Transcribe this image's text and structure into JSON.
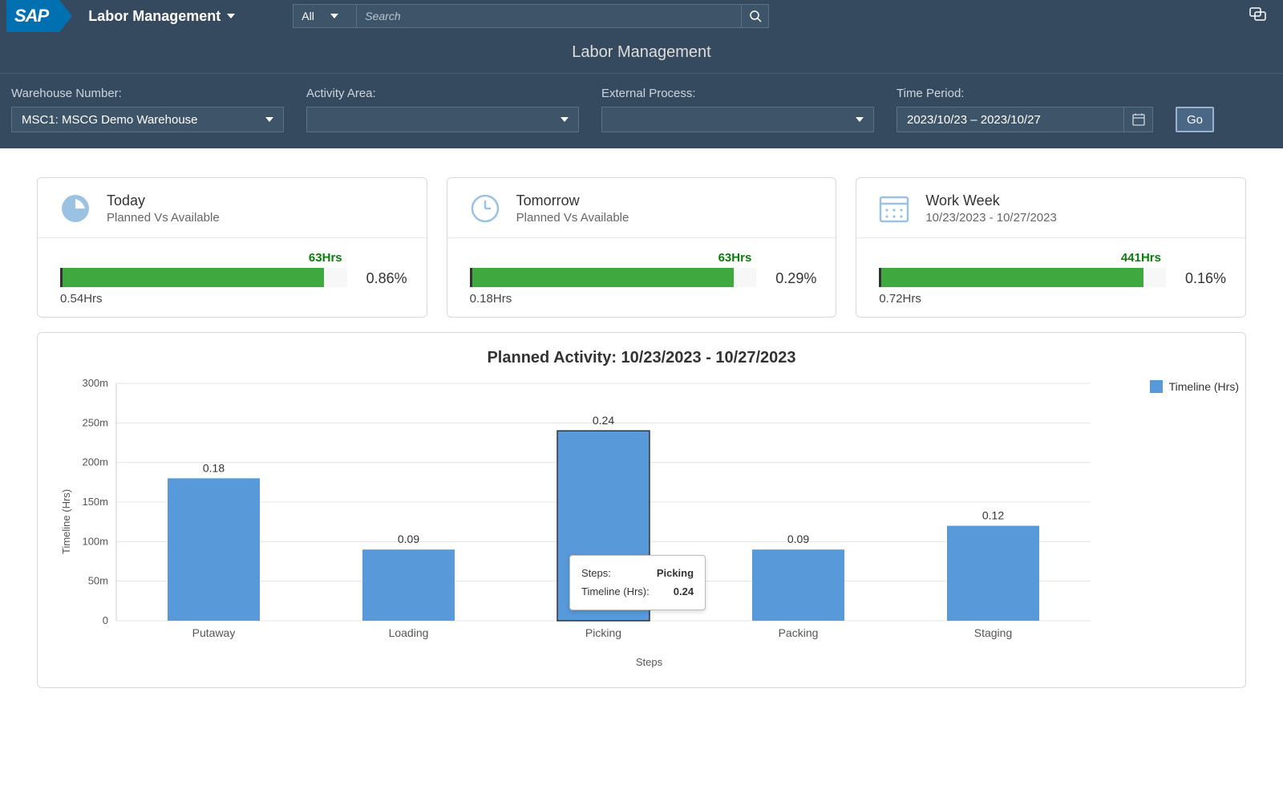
{
  "header": {
    "logo_text": "SAP",
    "app_title": "Labor Management",
    "search_scope": "All",
    "search_placeholder": "Search"
  },
  "page": {
    "title": "Labor Management"
  },
  "filters": {
    "warehouse": {
      "label": "Warehouse Number:",
      "value": "MSC1: MSCG Demo Warehouse"
    },
    "activity": {
      "label": "Activity Area:",
      "value": ""
    },
    "external": {
      "label": "External Process:",
      "value": ""
    },
    "period": {
      "label": "Time Period:",
      "value": "2023/10/23 – 2023/10/27"
    },
    "go_label": "Go"
  },
  "kpi_cards": [
    {
      "title": "Today",
      "subtitle": "Planned Vs Available",
      "top_label": "63Hrs",
      "bottom_label": "0.54Hrs",
      "pct": "0.86%",
      "fill_pct": 92
    },
    {
      "title": "Tomorrow",
      "subtitle": "Planned Vs Available",
      "top_label": "63Hrs",
      "bottom_label": "0.18Hrs",
      "pct": "0.29%",
      "fill_pct": 92
    },
    {
      "title": "Work Week",
      "subtitle": "10/23/2023 - 10/27/2023",
      "top_label": "441Hrs",
      "bottom_label": "0.72Hrs",
      "pct": "0.16%",
      "fill_pct": 92
    }
  ],
  "chart_data": {
    "type": "bar",
    "title": "Planned Activity: 10/23/2023 - 10/27/2023",
    "xlabel": "Steps",
    "ylabel": "Timeline (Hrs)",
    "legend": "Timeline (Hrs)",
    "categories": [
      "Putaway",
      "Loading",
      "Picking",
      "Packing",
      "Staging"
    ],
    "values_label": [
      "0.18",
      "0.09",
      "0.24",
      "0.09",
      "0.12"
    ],
    "values_m": [
      180,
      90,
      240,
      90,
      120
    ],
    "y_ticks": [
      "0",
      "50m",
      "100m",
      "150m",
      "200m",
      "250m",
      "300m"
    ],
    "ymax": 300,
    "highlight_index": 2,
    "tooltip": {
      "row1_label": "Steps:",
      "row1_value": "Picking",
      "row2_label": "Timeline (Hrs):",
      "row2_value": "0.24"
    }
  }
}
